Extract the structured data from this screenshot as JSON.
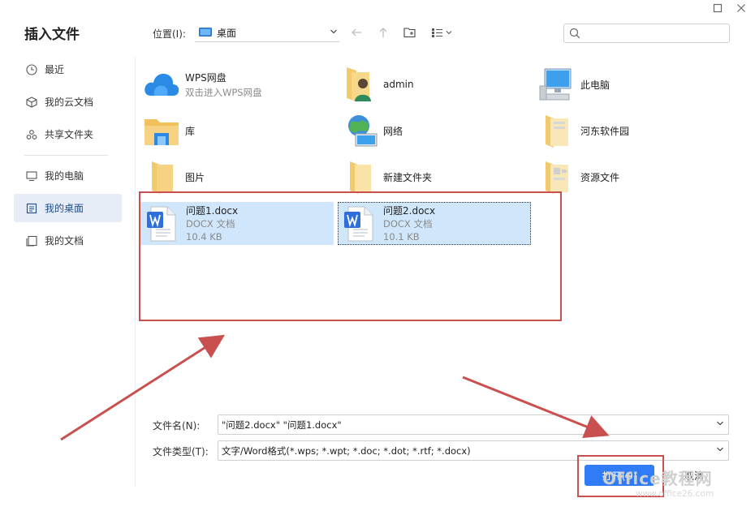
{
  "window": {
    "maximize_icon": "maximize-icon",
    "close_icon": "close-icon"
  },
  "dialog": {
    "title": "插入文件"
  },
  "sidebar": {
    "items": [
      {
        "label": "最近",
        "icon": "clock-icon"
      },
      {
        "label": "我的云文档",
        "icon": "cloud-box-icon"
      },
      {
        "label": "共享文件夹",
        "icon": "share-group-icon"
      },
      {
        "label": "我的电脑",
        "icon": "monitor-icon"
      },
      {
        "label": "我的桌面",
        "icon": "desktop-icon",
        "active": true
      },
      {
        "label": "我的文档",
        "icon": "documents-icon"
      }
    ]
  },
  "toolbar": {
    "location_label": "位置(I):",
    "location_value": "桌面",
    "back_icon": "arrow-left-icon",
    "up_icon": "arrow-up-icon",
    "new_folder_icon": "new-folder-icon",
    "view_icon": "view-list-icon",
    "search_placeholder": ""
  },
  "grid": {
    "items": [
      {
        "name": "WPS网盘",
        "sub": "双击进入WPS网盘",
        "icon": "cloud-icon"
      },
      {
        "name": "admin",
        "icon": "user-folder-icon"
      },
      {
        "name": "此电脑",
        "icon": "computer-icon"
      },
      {
        "name": "库",
        "icon": "library-folder-icon"
      },
      {
        "name": "网络",
        "icon": "network-icon"
      },
      {
        "name": "河东软件园",
        "icon": "folder-icon"
      },
      {
        "name": "图片",
        "icon": "folder-icon"
      },
      {
        "name": "新建文件夹",
        "icon": "folder-icon"
      },
      {
        "name": "资源文件",
        "icon": "folder-icon"
      }
    ],
    "files": [
      {
        "name": "问题1.docx",
        "type": "DOCX 文档",
        "size": "10.4 KB",
        "icon": "wps-word-doc-icon"
      },
      {
        "name": "问题2.docx",
        "type": "DOCX 文档",
        "size": "10.1 KB",
        "icon": "wps-word-doc-icon"
      }
    ]
  },
  "form": {
    "filename_label": "文件名(N):",
    "filename_value": "\"问题2.docx\" \"问题1.docx\"",
    "filetype_label": "文件类型(T):",
    "filetype_value": "文字/Word格式(*.wps; *.wpt; *.doc; *.dot; *.rtf; *.docx)"
  },
  "buttons": {
    "open_label": "打开(O)",
    "cancel_label": "取消"
  },
  "watermark": {
    "text": "Office教程网",
    "url": "www.office26.com"
  },
  "colors": {
    "accent": "#2f7cf6",
    "selection": "#cfe6fb",
    "annotation": "#c9504f"
  }
}
